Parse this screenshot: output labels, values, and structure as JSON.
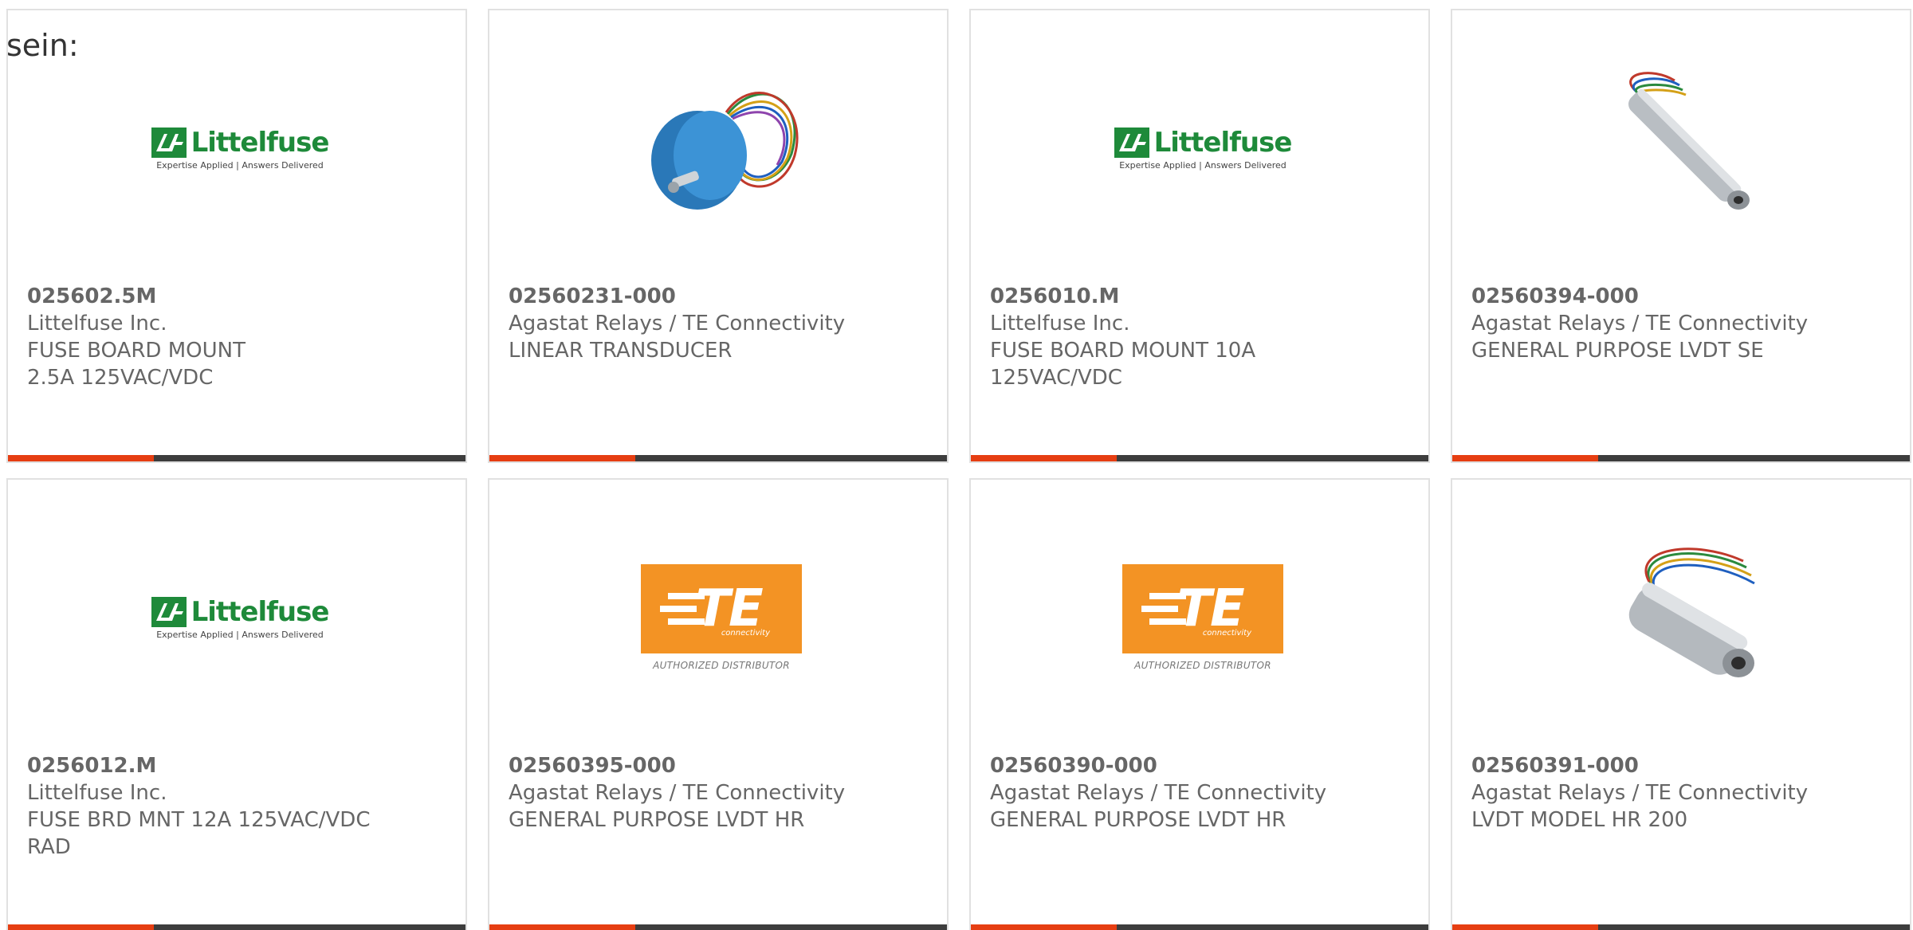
{
  "prefix_text": "sein:",
  "logos": {
    "littelfuse_name": "Littelfuse",
    "littelfuse_tagline": "Expertise Applied | Answers Delivered",
    "te_letters": "TE",
    "te_sub": "connectivity",
    "te_authorized": "AUTHORIZED DISTRIBUTOR"
  },
  "colors": {
    "accent": "#e63e12",
    "bar": "#3d3d3d",
    "littelfuse_green": "#1e8a3a",
    "te_orange": "#f39324"
  },
  "products": [
    {
      "part": "025602.5M",
      "manufacturer": "Littelfuse Inc.",
      "description": "FUSE BOARD MOUNT 2.5A 125VAC/VDC",
      "image": "littelfuse-logo"
    },
    {
      "part": "02560231-000",
      "manufacturer": "Agastat Relays / TE Connectivity",
      "description": "LINEAR TRANSDUCER",
      "image": "rotary-encoder-photo"
    },
    {
      "part": "0256010.M",
      "manufacturer": "Littelfuse Inc.",
      "description": "FUSE BOARD MOUNT 10A 125VAC/VDC",
      "image": "littelfuse-logo"
    },
    {
      "part": "02560394-000",
      "manufacturer": "Agastat Relays / TE Connectivity",
      "description": "GENERAL PURPOSE LVDT SE",
      "image": "lvdt-long-photo"
    },
    {
      "part": "0256012.M",
      "manufacturer": "Littelfuse Inc.",
      "description": "FUSE BRD MNT 12A 125VAC/VDC RAD",
      "image": "littelfuse-logo"
    },
    {
      "part": "02560395-000",
      "manufacturer": "Agastat Relays / TE Connectivity",
      "description": "GENERAL PURPOSE LVDT HR",
      "image": "te-logo"
    },
    {
      "part": "02560390-000",
      "manufacturer": "Agastat Relays / TE Connectivity",
      "description": "GENERAL PURPOSE LVDT HR",
      "image": "te-logo"
    },
    {
      "part": "02560391-000",
      "manufacturer": "Agastat Relays / TE Connectivity",
      "description": "LVDT MODEL HR 200",
      "image": "lvdt-short-photo"
    }
  ]
}
